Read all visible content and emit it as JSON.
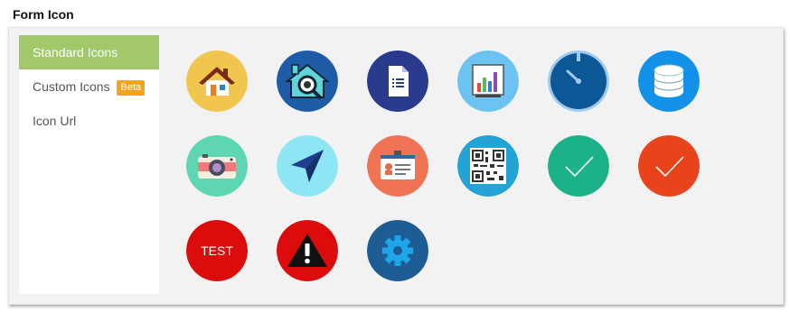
{
  "header": {
    "title": "Form Icon"
  },
  "sidebar": {
    "items": [
      {
        "label": "Standard Icons",
        "active": true
      },
      {
        "label": "Custom Icons",
        "badge": "Beta"
      },
      {
        "label": "Icon Url"
      }
    ]
  },
  "icons": [
    {
      "name": "home-icon",
      "color": "#f0c64e"
    },
    {
      "name": "house-inspection-icon",
      "color": "#1e5ca8"
    },
    {
      "name": "document-list-icon",
      "color": "#2a3a8c"
    },
    {
      "name": "bar-chart-icon",
      "color": "#6cc3f2"
    },
    {
      "name": "timer-icon",
      "color": "#0c5796"
    },
    {
      "name": "database-icon",
      "color": "#1391e8"
    },
    {
      "name": "camera-icon",
      "color": "#5ed6b4"
    },
    {
      "name": "navigation-arrow-icon",
      "color": "#8ee6f4"
    },
    {
      "name": "id-card-icon",
      "color": "#ee7454"
    },
    {
      "name": "qr-code-icon",
      "color": "#23a3d6"
    },
    {
      "name": "check-green-icon",
      "color": "#1bb28a"
    },
    {
      "name": "check-orange-icon",
      "color": "#e8431b"
    },
    {
      "name": "test-icon",
      "color": "#dd0c0c",
      "text": "TEST"
    },
    {
      "name": "warning-icon",
      "color": "#dd0c0c"
    },
    {
      "name": "gear-icon",
      "color": "#1d5c95"
    }
  ]
}
